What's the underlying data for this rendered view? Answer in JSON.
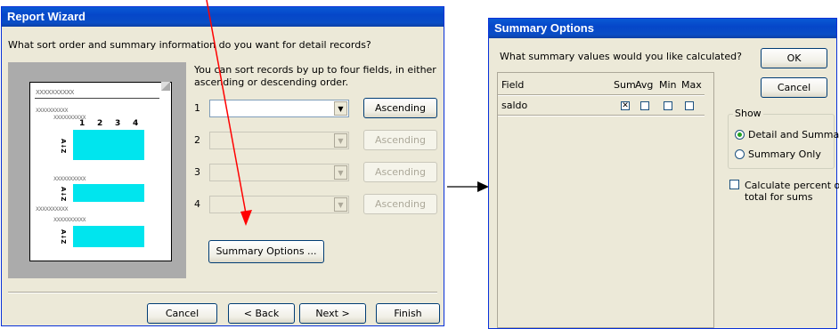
{
  "wizard": {
    "title": "Report Wizard",
    "question": "What sort order and summary information do you want for detail records?",
    "instructions_line1": "You can sort records by up to four fields, in either",
    "instructions_line2": "ascending or descending order.",
    "sort_rows": [
      {
        "number": "1",
        "button": "Ascending"
      },
      {
        "number": "2",
        "button": "Ascending"
      },
      {
        "number": "3",
        "button": "Ascending"
      },
      {
        "number": "4",
        "button": "Ascending"
      }
    ],
    "summary_button": "Summary Options ...",
    "buttons": {
      "cancel": "Cancel",
      "back": "< Back",
      "next": "Next >",
      "finish": "Finish"
    },
    "preview": {
      "placeholder": "XXXXXXXXXX",
      "columns": [
        "1",
        "2",
        "3",
        "4"
      ],
      "sort_glyph": "A↓Z"
    }
  },
  "summary": {
    "title": "Summary Options",
    "question": "What summary values would you like calculated?",
    "headers": {
      "field": "Field",
      "sum": "Sum",
      "avg": "Avg",
      "min": "Min",
      "max": "Max"
    },
    "rows": [
      {
        "field": "saldo",
        "sum": true,
        "avg": false,
        "min": false,
        "max": false
      }
    ],
    "ok": "OK",
    "cancel": "Cancel",
    "show_group": "Show",
    "show_options": [
      {
        "label": "Detail and Summary",
        "selected": true
      },
      {
        "label": "Summary Only",
        "selected": false
      }
    ],
    "percent_line1": "Calculate percent of",
    "percent_line2": "total for sums",
    "percent_checked": false
  },
  "colors": {
    "title_bar": "#0a5ad4",
    "annotation_arrow": "#ff0000",
    "preview_highlight": "#00e5ee"
  }
}
